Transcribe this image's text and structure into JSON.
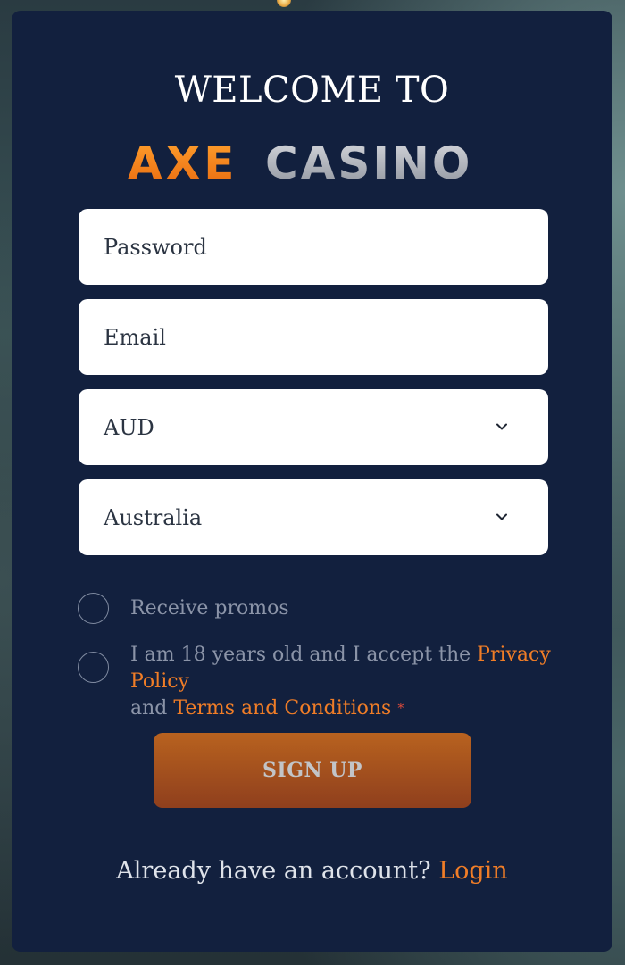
{
  "header": {
    "welcome": "WELCOME TO",
    "logo_word_1": "AXE",
    "logo_word_2": "CASINO"
  },
  "form": {
    "password_placeholder": "Password",
    "email_placeholder": "Email",
    "currency_value": "AUD",
    "country_value": "Australia"
  },
  "checks": {
    "promos_label": "Receive promos",
    "age_text_1": "I am 18 years old and I accept the",
    "privacy_policy": "Privacy Policy",
    "and": "and",
    "terms": "Terms and Conditions",
    "required_mark": "*"
  },
  "actions": {
    "signup_label": "SIGN UP",
    "already_text": "Already have an account?",
    "login_label": "Login"
  },
  "colors": {
    "card": "#12203e",
    "accent_orange": "#f07d27",
    "button_top": "#b8621f",
    "button_bottom": "#8f3f1d"
  },
  "icons": {
    "select_arrow": "chevron-down-icon"
  }
}
